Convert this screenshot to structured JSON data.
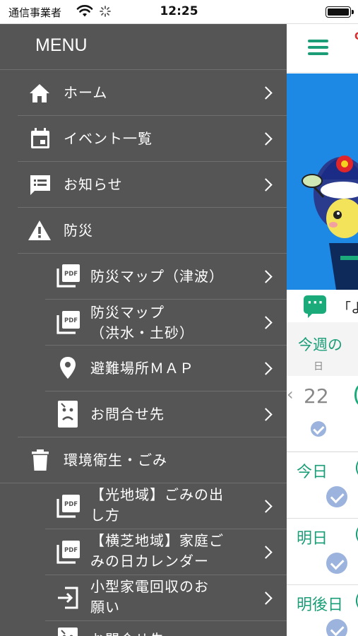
{
  "status": {
    "carrier": "通信事業者",
    "time": "12:25"
  },
  "drawer": {
    "title": "MENU",
    "items": [
      {
        "label": "ホーム",
        "icon": "home-icon"
      },
      {
        "label": "イベント一覧",
        "icon": "calendar-icon"
      },
      {
        "label": "お知らせ",
        "icon": "message-list-icon"
      },
      {
        "label": "防災",
        "icon": "warning-icon"
      },
      {
        "label": "防災マップ（津波）",
        "icon": "pdf-icon"
      },
      {
        "label": "防災マップ",
        "label2": "（洪水・土砂）",
        "icon": "pdf-icon"
      },
      {
        "label": "避難場所ＭＡＰ",
        "icon": "location-pin-icon"
      },
      {
        "label": "お問合せ先",
        "icon": "contact-icon"
      },
      {
        "label": "環境衛生・ごみ",
        "icon": "trash-icon"
      },
      {
        "label": "【光地域】ごみの出",
        "label2": "し方",
        "icon": "pdf-icon"
      },
      {
        "label": "【横芝地域】家庭ご",
        "label2": "みの日カレンダー",
        "icon": "pdf-icon"
      },
      {
        "label": "小型家電回収のお",
        "label2": "願い",
        "icon": "exit-arrow-icon"
      },
      {
        "label": "お問合せ先",
        "icon": "contact-icon"
      }
    ]
  },
  "main": {
    "notice_text": "「よ",
    "week_title": "今週の",
    "week_day_header": "日",
    "date_number": "22",
    "rows": [
      {
        "label": "今日"
      },
      {
        "label": "明日"
      },
      {
        "label": "明後日"
      }
    ]
  },
  "colors": {
    "drawer_bg": "#555555",
    "accent_green": "#1b9e78",
    "banner_blue": "#1e88e5",
    "check_blue": "#9bb3dd"
  }
}
